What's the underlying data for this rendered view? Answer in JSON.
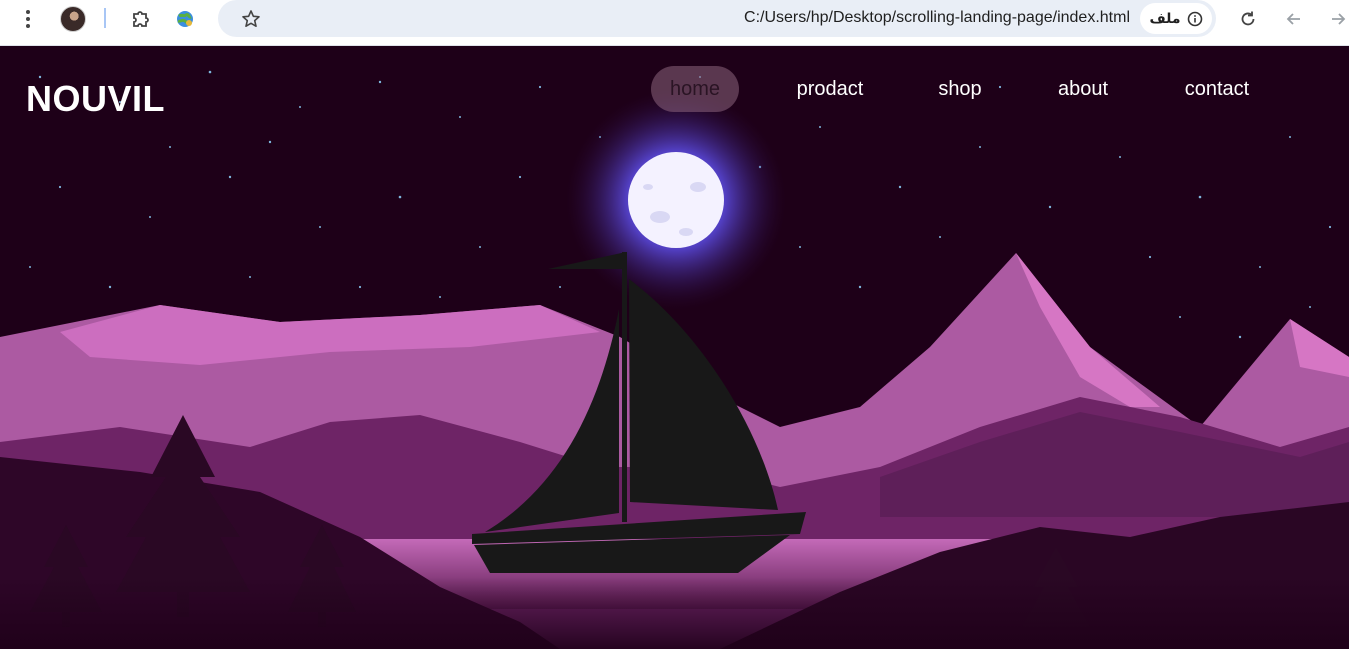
{
  "browser": {
    "url": "C:/Users/hp/Desktop/scrolling-landing-page/index.html",
    "site_chip_label": "ملف",
    "icons": [
      "more-vert-icon",
      "profile-avatar",
      "extensions-icon",
      "globe-extension-icon",
      "bookmark-star-icon",
      "info-icon",
      "reload-icon",
      "back-arrow-icon",
      "forward-arrow-icon"
    ]
  },
  "site": {
    "logo": "NOUVIL",
    "nav": [
      {
        "label": "home",
        "active": true
      },
      {
        "label": "prodact",
        "active": false
      },
      {
        "label": "shop",
        "active": false
      },
      {
        "label": "about",
        "active": false
      },
      {
        "label": "contact",
        "active": false
      }
    ]
  },
  "colors": {
    "sky": "#1e0018",
    "mountain_far": "#b25ca6",
    "mountain_highlight": "#d676c4",
    "mountain_mid": "#6e2466",
    "hills_dark": "#2e0628",
    "water": "#b260a8",
    "moon": "#f4f2ff",
    "moon_glow": "#6a5cff",
    "boat": "#181818",
    "nav_active_bg": "#8c647d"
  }
}
